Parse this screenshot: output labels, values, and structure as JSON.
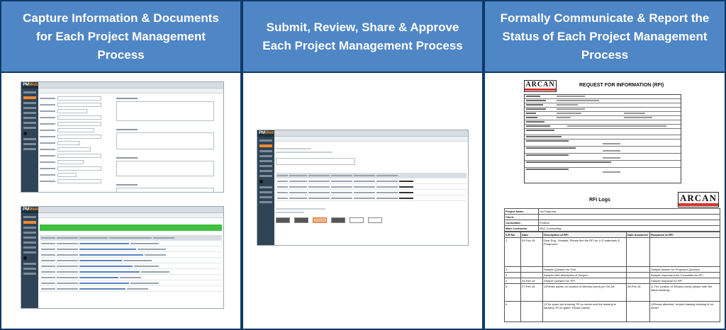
{
  "columns": [
    {
      "title": "Capture Information & Documents\nfor Each Project Management\nProcess"
    },
    {
      "title": "Submit, Review, Share & Approve\nEach Project Management Process"
    },
    {
      "title": "Formally Communicate & Report the\nStatus of Each Project Management\nProcess"
    }
  ],
  "app": {
    "logo_pre": "PM",
    "logo_post": "Web"
  },
  "reports": {
    "brand": "ARCAN",
    "rfi_title": "REQUEST FOR INFORMATION (RFI)",
    "rfi_log_title": "RFI Logs",
    "log_fields": [
      {
        "label": "Project Name",
        "value": "Uni Parkrond"
      },
      {
        "label": "Client",
        "value": ""
      },
      {
        "label": "Consultant",
        "value": "Federal"
      },
      {
        "label": "Main Contractor",
        "value": "RAG Contracting"
      }
    ],
    "log_headers": [
      "S.R No",
      "Date",
      "Description of RFI",
      "Date Answered",
      "Response to RFI"
    ],
    "log_rows": [
      {
        "no": "1",
        "date": "03-Feb-18",
        "desc": "Dear Eng.. Mostafa. Please find the RFI for U.G watertank & Pumproom",
        "answered": "",
        "resp": ""
      },
      {
        "no": "2",
        "date": "",
        "desc": "Sample Question for Test",
        "answered": "",
        "resp": "Sample Answer for Proposed Question"
      },
      {
        "no": "3",
        "date": "",
        "desc": "Sample brief description of Subject",
        "answered": "",
        "resp": "Sample response from Consultant for RFI"
      },
      {
        "no": "4",
        "date": "24-Feb-18",
        "desc": "Sample Question for RFI",
        "answered": "",
        "resp": "Sample response for RFI"
      },
      {
        "no": "5",
        "date": "27-Feb-18",
        "desc": "1)Please advise on location of Window (sent) per SK-5A",
        "answered": "28-Feb-18",
        "resp": "1) The location of Window (sent) please refer the latest drawings"
      },
      {
        "no": "6",
        "date": "",
        "desc": "1)The spare pot showing TR on center and the drawing is showing TR on gutter. Please Advise",
        "answered": "",
        "resp": "1)Please attached, revised drawing showing tit on center"
      }
    ]
  }
}
